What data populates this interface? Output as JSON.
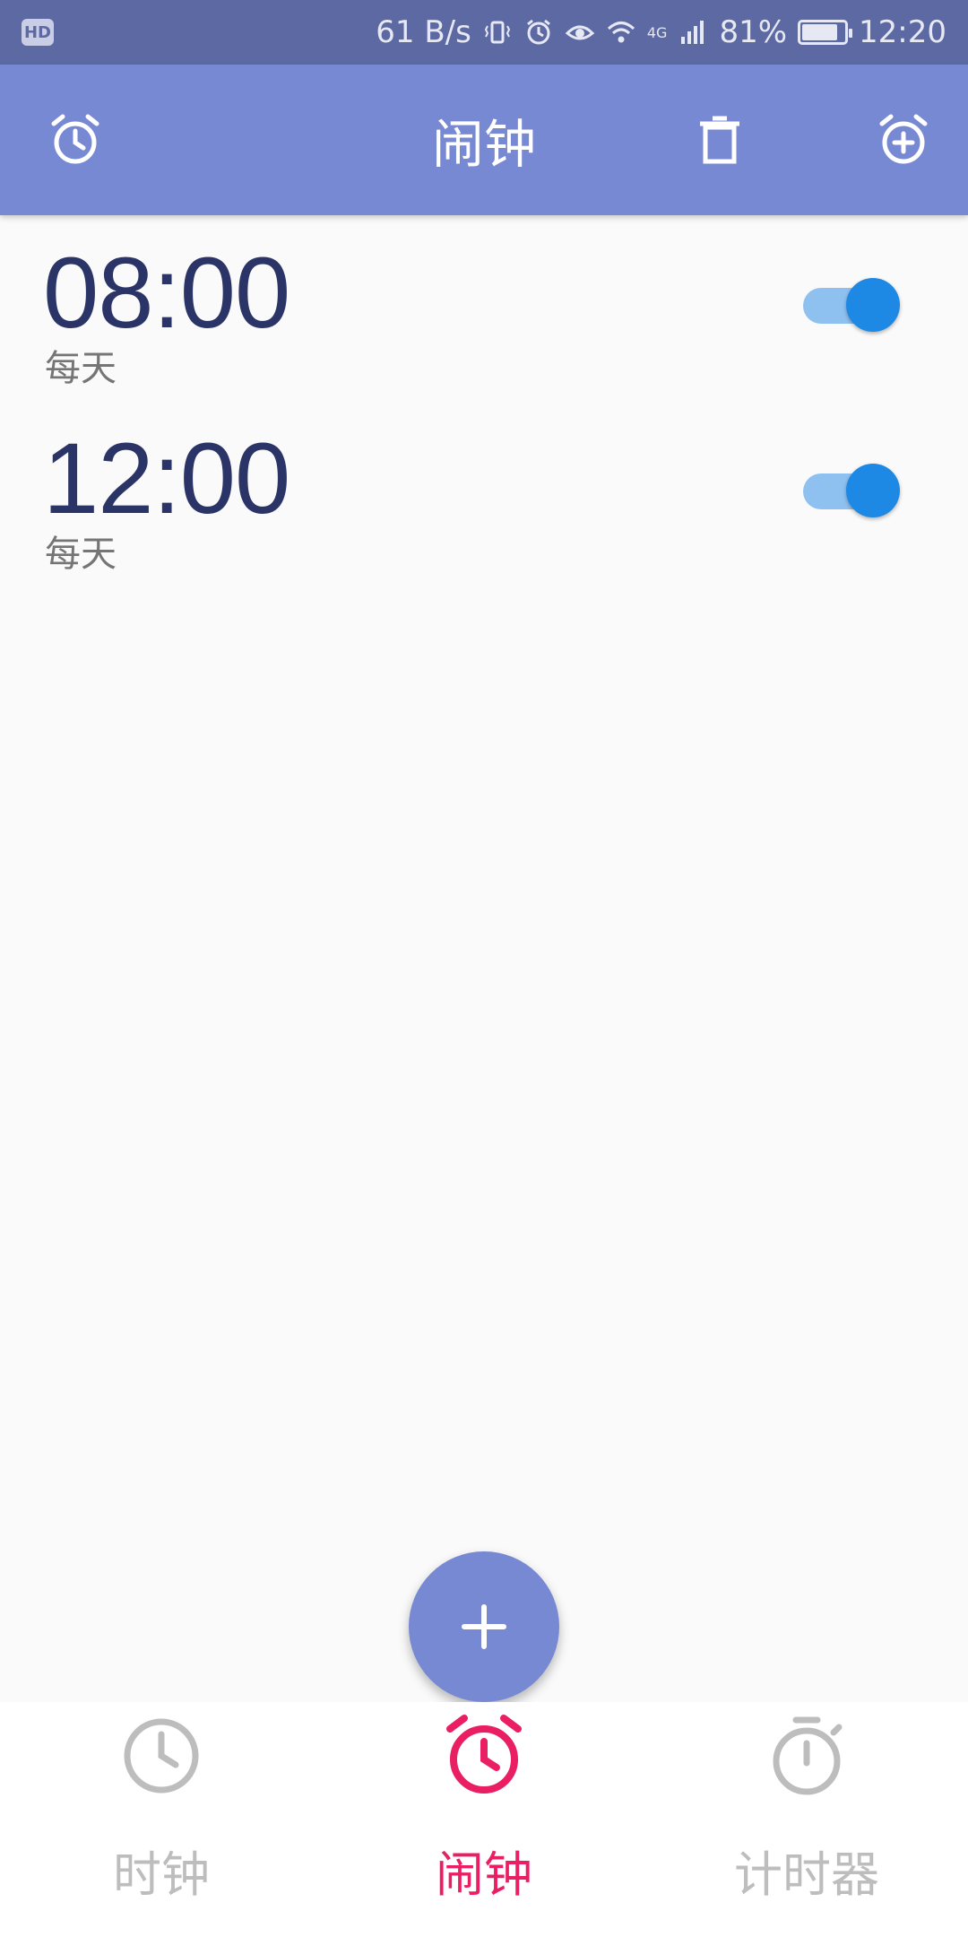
{
  "status_bar": {
    "badge": "HD",
    "net_speed": "61 B/s",
    "network_type": "4G",
    "battery": "81%",
    "time": "12:20"
  },
  "app_bar": {
    "title": "闹钟",
    "icons": [
      "alarm-clock-icon",
      "trash-icon",
      "alarm-add-icon"
    ]
  },
  "alarms": [
    {
      "time": "08:00",
      "repeat": "每天",
      "enabled": true
    },
    {
      "time": "12:00",
      "repeat": "每天",
      "enabled": true
    }
  ],
  "fab": {
    "label": "+"
  },
  "bottom_nav": [
    {
      "label": "时钟",
      "icon": "clock-icon",
      "active": false
    },
    {
      "label": "闹钟",
      "icon": "alarm-clock-icon",
      "active": true
    },
    {
      "label": "计时器",
      "icon": "stopwatch-icon",
      "active": false
    }
  ],
  "colors": {
    "status_bar": "#5c69a3",
    "app_bar": "#7889d4",
    "time_text": "#2b3466",
    "toggle_on": "#1e88e5",
    "toggle_track": "#8fc1f0",
    "active_tab": "#e91e63",
    "inactive_tab": "#bdbdbd"
  }
}
